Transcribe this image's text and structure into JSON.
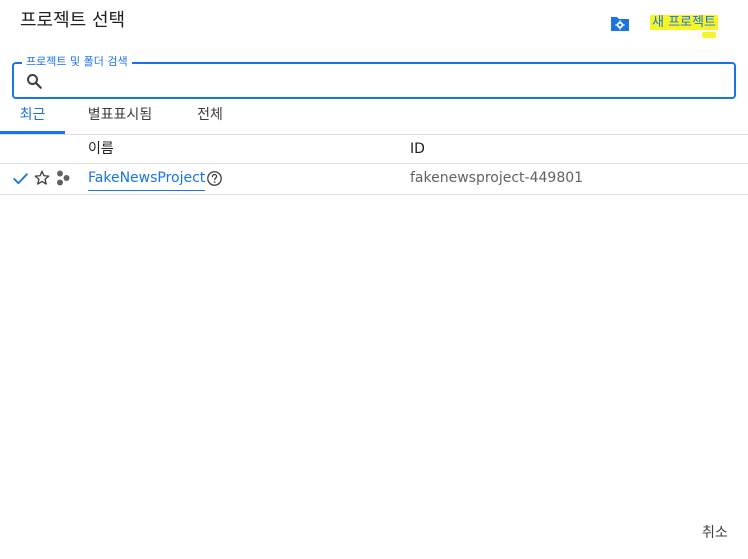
{
  "dialog": {
    "title": "프로젝트 선택",
    "new_project_label": "새 프로젝트",
    "manage_icon": "folder-gear-icon"
  },
  "search": {
    "legend": "프로젝트 및 폴더 검색",
    "value": "",
    "icon": "search-icon"
  },
  "tabs": [
    {
      "label": "최근",
      "active": true
    },
    {
      "label": "별표표시됨",
      "active": false
    },
    {
      "label": "전체",
      "active": false
    }
  ],
  "table": {
    "columns": [
      "이름",
      "ID"
    ],
    "rows": [
      {
        "selected": true,
        "starred": false,
        "name": "FakeNewsProject",
        "id": "fakenewsproject-449801"
      }
    ]
  },
  "footer": {
    "cancel_label": "취소"
  },
  "colors": {
    "accent": "#1a73e8",
    "highlight": "#f7f526",
    "text": "#202124",
    "muted": "#5f6368",
    "divider": "#dadce0"
  }
}
